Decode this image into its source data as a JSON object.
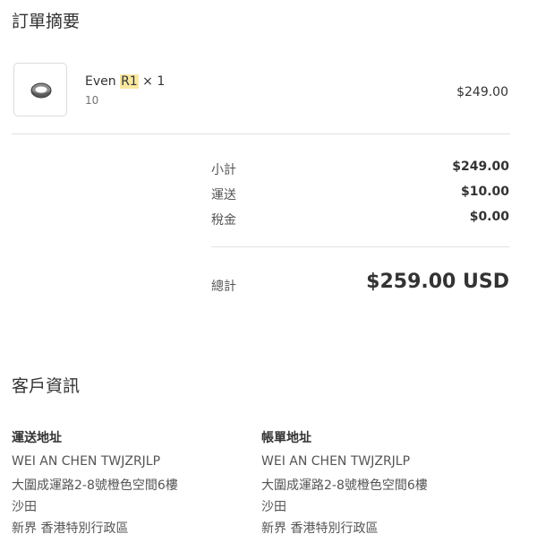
{
  "order_summary": {
    "title": "訂單摘要",
    "item": {
      "name_prefix": "Even ",
      "name_highlight": "R1",
      "name_suffix": " × 1",
      "variant": "10",
      "price": "$249.00",
      "image_icon": "ring-icon"
    },
    "subtotal": {
      "label": "小計",
      "value": "$249.00"
    },
    "shipping": {
      "label": "運送",
      "value": "$10.00"
    },
    "tax": {
      "label": "稅金",
      "value": "$0.00"
    },
    "total": {
      "label": "總計",
      "value": "$259.00 USD"
    }
  },
  "customer_info": {
    "title": "客戶資訊",
    "shipping_address": {
      "title": "運送地址",
      "lines": [
        "WEI AN CHEN TWJZRJLP",
        "大圍成運路2-8號橙色空間6樓",
        "沙田",
        "新界 香港特別行政區"
      ]
    },
    "billing_address": {
      "title": "帳單地址",
      "lines": [
        "WEI AN CHEN TWJZRJLP",
        "大圍成運路2-8號橙色空間6樓",
        "沙田",
        "新界 香港特別行政區"
      ]
    }
  }
}
